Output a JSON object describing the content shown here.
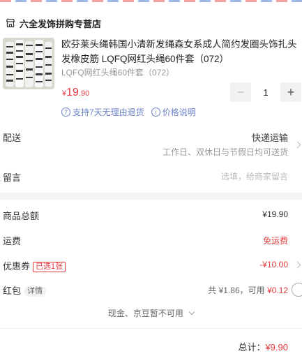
{
  "shop": {
    "name": "六全发饰拼购专营店",
    "icon": "store-icon"
  },
  "product": {
    "title": "欧芬莱头绳韩国小清新发绳森女系成人简约发圈头饰扎头发橡皮筋 LQFQ网红头绳60件套（072）",
    "spec": "LQFQ网红头绳60件套（072）",
    "price": {
      "currency": "¥",
      "integer": "19",
      "decimal": ".90"
    },
    "quantity": "1",
    "minus": "−",
    "plus": "+"
  },
  "services": [
    {
      "icon": "seven-day-return-icon",
      "icon_text": "7",
      "label": "支持7天无理由退货"
    },
    {
      "icon": "info-icon",
      "icon_text": "i",
      "label": "价格说明"
    }
  ],
  "delivery": {
    "label": "配送",
    "method": "快递运输",
    "time": "工作日、双休日与节假日均可送货"
  },
  "message": {
    "label": "留言",
    "placeholder": "选填，给商家留言"
  },
  "summary": {
    "subtotal_label": "商品总额",
    "subtotal_value": "¥19.90",
    "shipping_label": "运费",
    "shipping_value": "免运费",
    "coupon_label": "优惠券",
    "coupon_tag": "已选1张",
    "coupon_value": "-¥10.00",
    "redpacket_label": "红包",
    "redpacket_detail": "详情",
    "redpacket_info": "共 ¥1.86，可用",
    "redpacket_value": "¥0.12"
  },
  "cash_note": "现金、京豆暂不可用",
  "total": {
    "label": "总计：",
    "value": "¥9.90"
  },
  "colors": {
    "accent": "#e4393c",
    "link": "#6b83c9"
  }
}
